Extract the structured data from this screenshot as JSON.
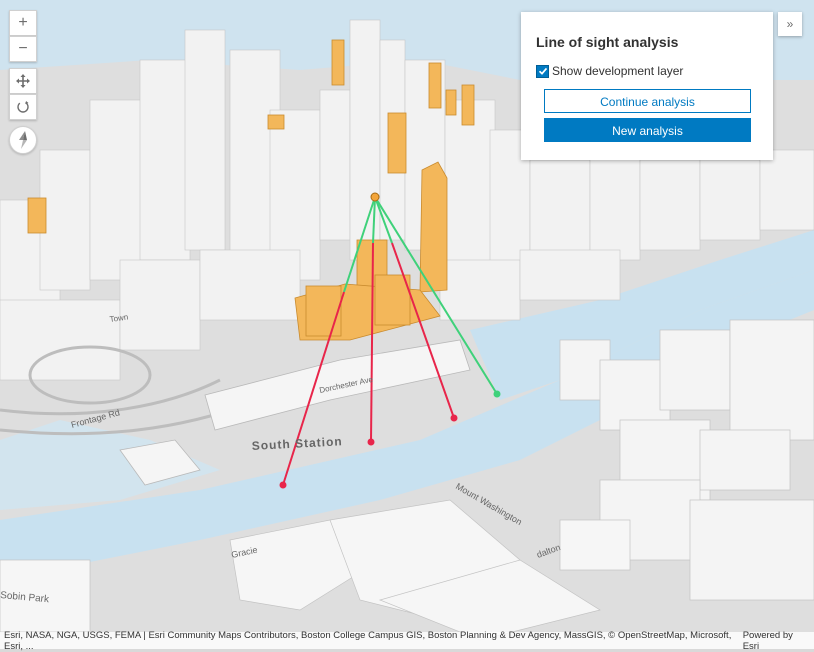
{
  "map": {
    "labels": {
      "south_station": "South Station",
      "dorchester_ave": "Dorchester Ave",
      "frontage_rd": "Frontage Rd",
      "mount_washington": "Mount Washington",
      "gracie": "Gracie",
      "dalton": "dalton",
      "park": "Sobin Park",
      "town": "Town"
    }
  },
  "controls": {
    "zoom_in": "+",
    "zoom_out": "−"
  },
  "panel": {
    "title": "Line of sight analysis",
    "show_layer_label": "Show development layer",
    "show_layer_checked": true,
    "continue_label": "Continue analysis",
    "new_label": "New analysis"
  },
  "expand_icon_text": "»",
  "attribution": {
    "sources": "Esri, NASA, NGA, USGS, FEMA | Esri Community Maps Contributors, Boston College Campus GIS, Boston Planning & Dev Agency, MassGIS, © OpenStreetMap, Microsoft, Esri, ...",
    "powered": "Powered by Esri"
  },
  "colors": {
    "accent": "#007ac2",
    "visible_line": "#3fd17a",
    "blocked_line": "#e8254a",
    "development": "#f3b75a",
    "water": "#c8e1f0"
  }
}
